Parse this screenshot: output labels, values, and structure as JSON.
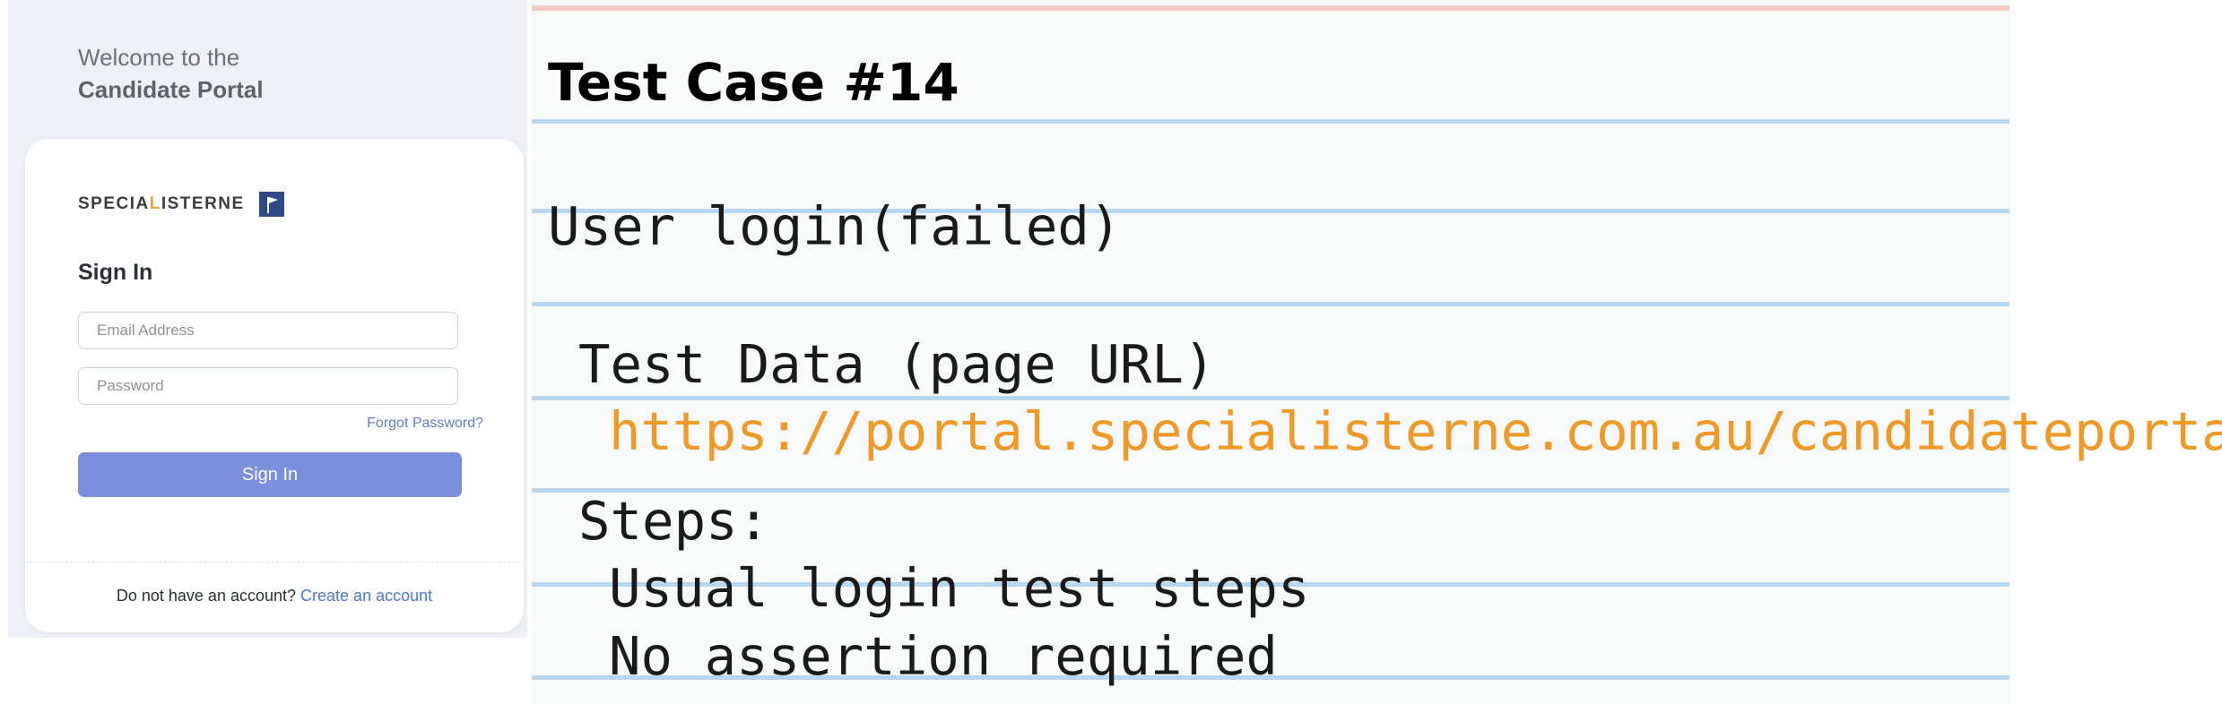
{
  "portal": {
    "welcome_line1": "Welcome to the",
    "welcome_line2": "Candidate Portal",
    "logo": {
      "text_before": "SPECIA",
      "text_highlight": "L",
      "text_after": "ISTERNE",
      "flag_icon": "flag-icon"
    },
    "signin_title": "Sign In",
    "email_placeholder": "Email Address",
    "email_value": "",
    "password_placeholder": "Password",
    "password_value": "",
    "forgot_password": "Forgot Password?",
    "signin_button": "Sign In",
    "signup_prompt": "Do not have an account?",
    "create_account": "Create an account",
    "colors": {
      "button": "#7a8fdb",
      "link": "#4a79d1",
      "panel_bg": "#eef0f6"
    }
  },
  "test_case": {
    "title": "Test Case #14",
    "name": "User login(failed)",
    "test_data_label": "Test Data (page URL)",
    "url": "https://portal.specialisterne.com.au/candidateportal",
    "steps_label": "Steps:",
    "steps": [
      "Usual login test steps",
      "No assertion required"
    ],
    "colors": {
      "url": "#f09a25",
      "rule_line": "#b5d7f3",
      "top_line": "#f7c9c4"
    }
  }
}
